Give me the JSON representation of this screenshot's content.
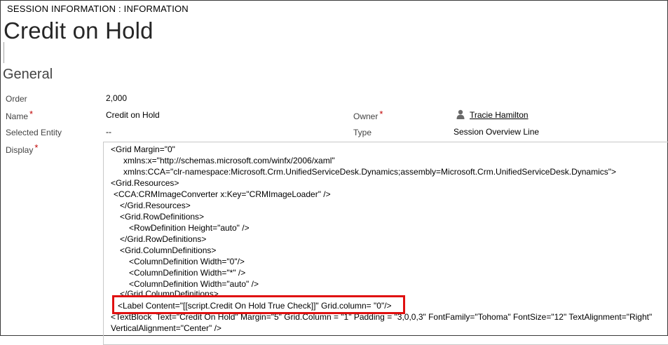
{
  "header": {
    "breadcrumb": "SESSION INFORMATION : INFORMATION",
    "title": "Credit on Hold"
  },
  "section": {
    "title": "General"
  },
  "fields": {
    "order": {
      "label": "Order",
      "value": "2,000"
    },
    "name": {
      "label": "Name",
      "required": "*",
      "value": "Credit on Hold"
    },
    "owner": {
      "label": "Owner",
      "required": "*",
      "value": "Tracie Hamilton"
    },
    "selected_entity": {
      "label": "Selected Entity",
      "value": "--"
    },
    "type": {
      "label": "Type",
      "value": "Session Overview Line"
    },
    "display": {
      "label": "Display",
      "required": "*"
    }
  },
  "code": {
    "lines": [
      "<Grid Margin=\"0\"",
      "xmlns:x=\"http://schemas.microsoft.com/winfx/2006/xaml\"",
      "xmlns:CCA=\"clr-namespace:Microsoft.Crm.UnifiedServiceDesk.Dynamics;assembly=Microsoft.Crm.UnifiedServiceDesk.Dynamics\">",
      "<Grid.Resources>",
      "<CCA:CRMImageConverter x:Key=\"CRMImageLoader\" />",
      "</Grid.Resources>",
      "<Grid.RowDefinitions>",
      "<RowDefinition Height=\"auto\" />",
      "</Grid.RowDefinitions>",
      "<Grid.ColumnDefinitions>",
      "<ColumnDefinition Width=\"0\"/>",
      "<ColumnDefinition Width=\"*\" />",
      "<ColumnDefinition Width=\"auto\" />",
      "</Grid.ColumnDefinitions>",
      "<Label Content=\"[[script.Credit On Hold True Check]]\" Grid.column= \"0\"/>",
      "<TextBlock  Text=\"Credit On Hold\" Margin=\"5\" Grid.Column = \"1\" Padding = \"3,0,0,3\" FontFamily=\"Tohoma\" FontSize=\"12\" TextAlignment=\"Right\"",
      "VerticalAlignment=\"Center\" />"
    ]
  },
  "colors": {
    "highlight": "#e01010",
    "required": "#c00000"
  }
}
